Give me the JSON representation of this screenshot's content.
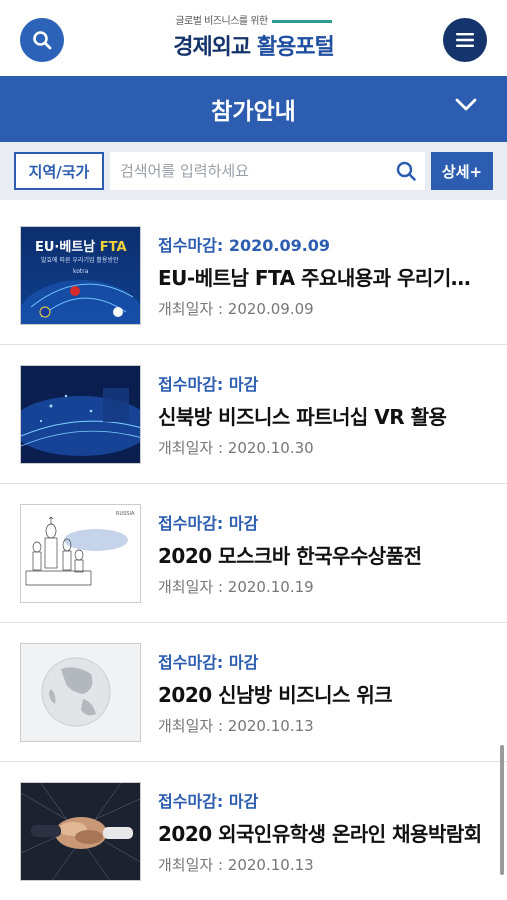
{
  "header": {
    "logo_sub": "글로벌 비즈니스를 위한",
    "logo_main_1": "경제외교 ",
    "logo_main_2": "활용포털",
    "search_icon": "search-icon",
    "menu_icon": "hamburger-menu-icon"
  },
  "title_bar": {
    "title": "참가안내",
    "chevron_icon": "chevron-down-icon"
  },
  "search": {
    "region_label": "지역/국가",
    "placeholder": "검색어를 입력하세요",
    "detail_label": "상세+"
  },
  "items": [
    {
      "deadline": "접수마감: 2020.09.09",
      "title": "EU-베트남 FTA 주요내용과 우리기업 활용방안",
      "date": "개최일자 : 2020.09.09",
      "thumb_title_1": "EU·베트남 ",
      "thumb_title_2": "FTA",
      "thumb_sub": "발효에 따른 우리기업 활용방안",
      "thumb_brand": "kotra"
    },
    {
      "deadline": "접수마감: 마감",
      "title": "신북방 비즈니스 파트너십 VR 활용",
      "date": "개최일자 : 2020.10.30"
    },
    {
      "deadline": "접수마감: 마감",
      "title": "2020 모스크바 한국우수상품전",
      "date": "개최일자 : 2020.10.19",
      "thumb_label": "RUSSIA"
    },
    {
      "deadline": "접수마감: 마감",
      "title": "2020 신남방 비즈니스 위크",
      "date": "개최일자 : 2020.10.13"
    },
    {
      "deadline": "접수마감: 마감",
      "title": "2020 외국인유학생 온라인 채용박람회",
      "date": "개최일자 : 2020.10.13"
    }
  ],
  "colors": {
    "primary": "#2d5db0",
    "navy": "#15346b",
    "accent_green": "#2a9d8f"
  }
}
